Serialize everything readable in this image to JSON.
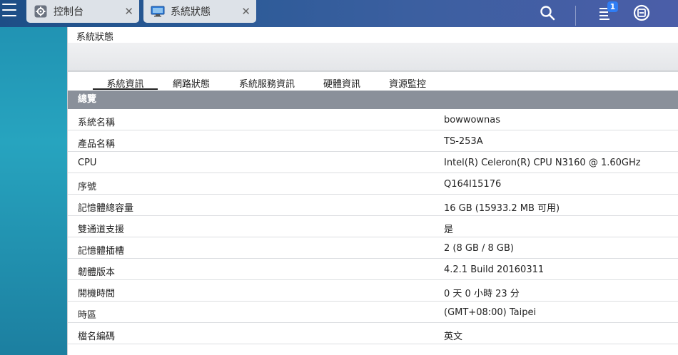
{
  "taskbar": {
    "tabs": [
      {
        "label": "控制台",
        "icon": "gear-icon"
      },
      {
        "label": "系統狀態",
        "icon": "monitor-icon"
      }
    ],
    "notification_count": "1",
    "icons": [
      "search-icon",
      "notification-icon",
      "sync-icon"
    ]
  },
  "window": {
    "title": "系統狀態",
    "tabs": [
      "系統資訊",
      "網路狀態",
      "系統服務資訊",
      "硬體資訊",
      "資源監控"
    ],
    "active_tab": "系統資訊",
    "section_title": "總覽",
    "rows": [
      {
        "key": "系統名稱",
        "value": "bowwownas"
      },
      {
        "key": "產品名稱",
        "value": "TS-253A"
      },
      {
        "key": "CPU",
        "value": "Intel(R) Celeron(R) CPU N3160 @ 1.60GHz"
      },
      {
        "key": "序號",
        "value": "Q164I15176"
      },
      {
        "key": "記憶體總容量",
        "value": "16 GB (15933.2 MB 可用)"
      },
      {
        "key": "雙通道支援",
        "value": "是"
      },
      {
        "key": "記憶體插槽",
        "value": "2 (8 GB / 8 GB)"
      },
      {
        "key": "韌體版本",
        "value": "4.2.1 Build 20160311"
      },
      {
        "key": "開機時間",
        "value": "0 天 0 小時 23 分"
      },
      {
        "key": "時區",
        "value": "(GMT+08:00) Taipei"
      },
      {
        "key": "檔名編碼",
        "value": "英文"
      }
    ]
  },
  "colors": {
    "section_header": "#8a909a",
    "taskbar": "#2a5a96",
    "desktop": "#27a4bf",
    "badge": "#2f7df4"
  }
}
